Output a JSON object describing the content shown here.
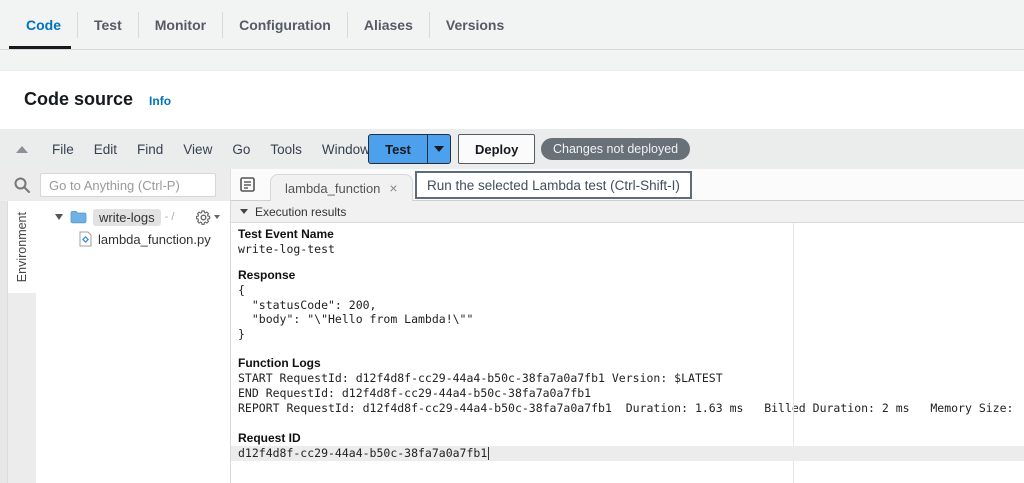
{
  "aws_tabs": {
    "items": [
      {
        "label": "Code",
        "active": true
      },
      {
        "label": "Test",
        "active": false
      },
      {
        "label": "Monitor",
        "active": false
      },
      {
        "label": "Configuration",
        "active": false
      },
      {
        "label": "Aliases",
        "active": false
      },
      {
        "label": "Versions",
        "active": false
      }
    ]
  },
  "header": {
    "title": "Code source",
    "info_link": "Info"
  },
  "menubar": {
    "items": [
      "File",
      "Edit",
      "Find",
      "View",
      "Go",
      "Tools",
      "Window"
    ],
    "test_button": "Test",
    "deploy_button": "Deploy",
    "badge": "Changes not deployed"
  },
  "toolbar": {
    "search_placeholder": "Go to Anything (Ctrl-P)",
    "tab_label": "lambda_function",
    "tab_close": "×",
    "tooltip": "Run the selected Lambda test (Ctrl-Shift-I)"
  },
  "sidebar": {
    "rail_label": "Environment",
    "folder_name": "write-logs",
    "folder_suffix": "- /",
    "file_name": "lambda_function.py"
  },
  "results": {
    "header": "Execution results",
    "test_event_name_label": "Test Event Name",
    "test_event_name": "write-log-test",
    "response_label": "Response",
    "response_json": "{\n  \"statusCode\": 200,\n  \"body\": \"\\\"Hello from Lambda!\\\"\"\n}",
    "function_logs_label": "Function Logs",
    "function_logs": "START RequestId: d12f4d8f-cc29-44a4-b50c-38fa7a0a7fb1 Version: $LATEST\nEND RequestId: d12f4d8f-cc29-44a4-b50c-38fa7a0a7fb1\nREPORT RequestId: d12f4d8f-cc29-44a4-b50c-38fa7a0a7fb1  Duration: 1.63 ms   Billed Duration: 2 ms   Memory Size:",
    "request_id_label": "Request ID",
    "request_id": "d12f4d8f-cc29-44a4-b50c-38fa7a0a7fb1"
  },
  "colors": {
    "accent_blue": "#0073bb",
    "test_button_blue": "#4da1ec",
    "badge_gray": "#687078",
    "topbar_gray": "#f2f3f3",
    "active_line_gray": "#ececec"
  }
}
